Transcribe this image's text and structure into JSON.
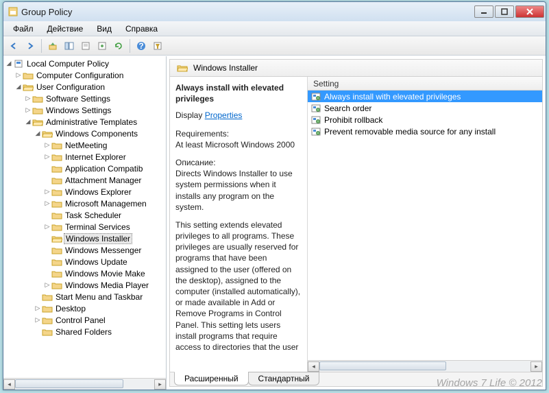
{
  "window": {
    "title": "Group Policy"
  },
  "menu": {
    "file": "Файл",
    "action": "Действие",
    "view": "Вид",
    "help": "Справка"
  },
  "tree": {
    "root": "Local Computer Policy",
    "computer_cfg": "Computer Configuration",
    "user_cfg": "User Configuration",
    "software_settings": "Software Settings",
    "windows_settings": "Windows Settings",
    "admin_templates": "Administrative Templates",
    "win_components": "Windows Components",
    "items": [
      "NetMeeting",
      "Internet Explorer",
      "Application Compatib",
      "Attachment Manager",
      "Windows Explorer",
      "Microsoft Managemen",
      "Task Scheduler",
      "Terminal Services",
      "Windows Installer",
      "Windows Messenger",
      "Windows Update",
      "Windows Movie Make",
      "Windows Media Player"
    ],
    "start_menu": "Start Menu and Taskbar",
    "desktop": "Desktop",
    "control_panel": "Control Panel",
    "shared_folders": "Shared Folders"
  },
  "right": {
    "header": "Windows Installer",
    "selected_title": "Always install with elevated privileges",
    "display_label": "Display",
    "properties_link": "Properties",
    "req_label": "Requirements:",
    "req_text": "At least Microsoft Windows 2000",
    "desc_label": "Описание:",
    "desc_p1": "Directs Windows Installer to use system permissions when it installs any program on the system.",
    "desc_p2": "This setting extends elevated privileges to all programs. These privileges are usually reserved for programs that have been assigned to the user (offered on the desktop), assigned to the computer (installed automatically), or made available in Add or Remove Programs in Control Panel. This setting lets users install programs that require access to directories that the user"
  },
  "list": {
    "header": "Setting",
    "items": [
      "Always install with elevated privileges",
      "Search order",
      "Prohibit rollback",
      "Prevent removable media source for any install"
    ]
  },
  "tabs": {
    "extended": "Расширенный",
    "standard": "Стандартный"
  },
  "watermark": "Windows 7 Life © 2012"
}
